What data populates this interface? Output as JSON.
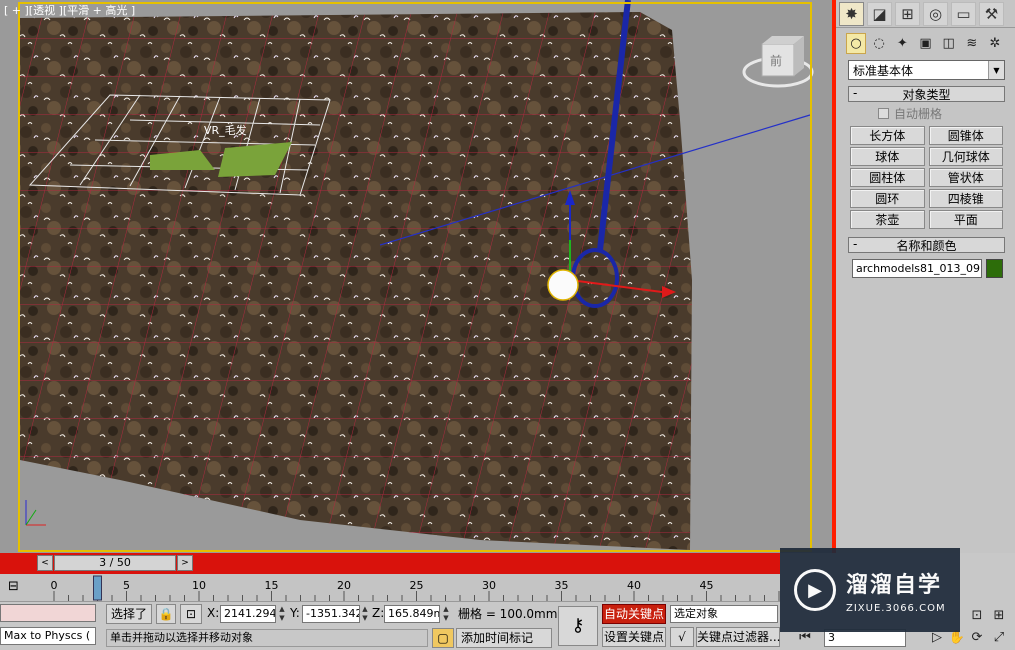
{
  "viewport": {
    "label": "[ + ][透视 ][平滑 + 高光 ]",
    "object_label": "VR_毛发",
    "viewcube_label": "前"
  },
  "command_panel": {
    "tabs": [
      "create-icon",
      "modify-icon",
      "hierarchy-icon",
      "motion-icon",
      "display-icon",
      "utilities-icon"
    ],
    "subtabs": [
      "geometry-icon",
      "shapes-icon",
      "lights-icon",
      "cameras-icon",
      "helpers-icon",
      "spacewarps-icon",
      "systems-icon"
    ],
    "category_dropdown": "标准基本体",
    "object_type": {
      "title": "对象类型",
      "autogrid_label": "自动栅格",
      "buttons": [
        "长方体",
        "圆锥体",
        "球体",
        "几何球体",
        "圆柱体",
        "管状体",
        "圆环",
        "四棱锥",
        "茶壶",
        "平面"
      ]
    },
    "name_color": {
      "title": "名称和颜色",
      "object_name": "archmodels81_013_09",
      "color": "#2d6d0a"
    }
  },
  "timeline": {
    "slider_label": "3 / 50",
    "prev": "<",
    "next": ">",
    "ticks": [
      "0",
      "5",
      "10",
      "15",
      "20",
      "25",
      "30",
      "35",
      "40",
      "45",
      "50"
    ]
  },
  "status": {
    "selection_label": "选择了",
    "maxscript_field": "Max to Physcs (",
    "x_label": "X:",
    "x_value": "2141.294m",
    "y_label": "Y:",
    "y_value": "-1351.342i",
    "z_label": "Z:",
    "z_value": "165.849mr",
    "grid_label": "栅格 = 100.0mm",
    "prompt": "单击并拖动以选择并移动对象",
    "add_time_tag": "添加时间标记",
    "auto_key": "自动关键点",
    "set_key": "设置关键点",
    "key_mode_dropdown": "选定对象",
    "key_filters": "关键点过滤器...",
    "frame_value": "3"
  },
  "watermark": {
    "title": "溜溜自学",
    "url": "ZIXUE.3066.COM"
  }
}
